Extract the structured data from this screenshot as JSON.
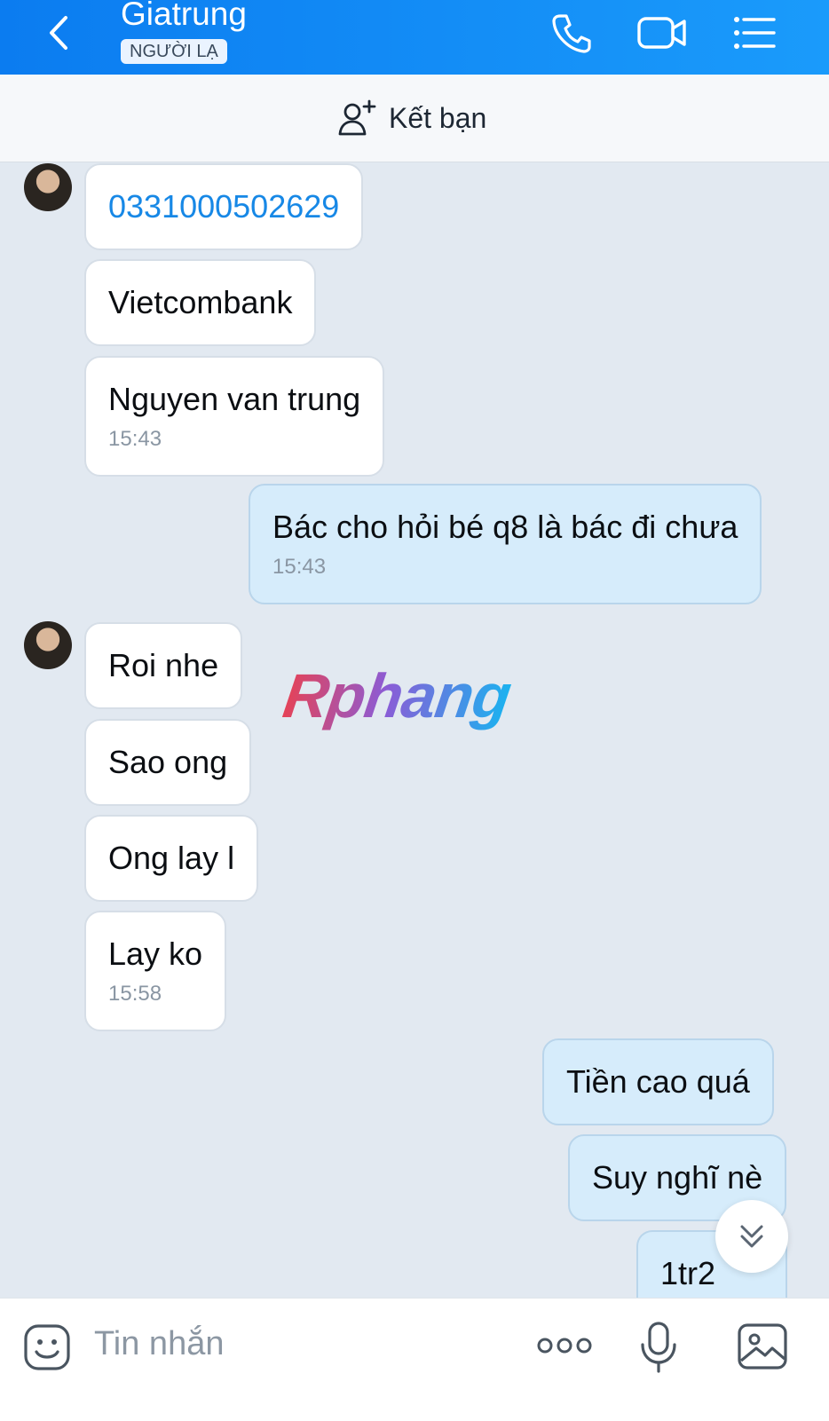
{
  "header": {
    "contact_name": "Giatrung",
    "badge": "NGƯỜI LẠ",
    "icons": [
      "back-icon",
      "phone-icon",
      "video-call-icon",
      "menu-list-icon"
    ]
  },
  "add_friend": {
    "label": "Kết bạn",
    "icon": "add-person-icon"
  },
  "messages": [
    {
      "side": "in",
      "text": "0331000502629",
      "style": "link"
    },
    {
      "side": "in",
      "text": "Vietcombank"
    },
    {
      "side": "in",
      "text": "Nguyen van trung",
      "time": "15:43"
    },
    {
      "side": "out",
      "text": "Bác cho hỏi bé q8 là bác đi chưa",
      "time": "15:43"
    },
    {
      "side": "in",
      "text": "Roi nhe"
    },
    {
      "side": "in",
      "text": "Sao ong"
    },
    {
      "side": "in",
      "text": "Ong lay l"
    },
    {
      "side": "in",
      "text": "Lay ko",
      "time": "15:58"
    },
    {
      "side": "out",
      "text": "Tiền cao quá"
    },
    {
      "side": "out",
      "text": "Suy nghĩ nè"
    },
    {
      "side": "out",
      "text": "1tr2"
    }
  ],
  "watermark": "Rphang",
  "input": {
    "placeholder": "Tin nhắn",
    "icons": [
      "sticker-icon",
      "more-icon",
      "microphone-icon",
      "image-icon"
    ]
  },
  "colors": {
    "header": "#0b7cf0",
    "outgoing_bubble": "#d6ecfb",
    "incoming_bubble": "#ffffff",
    "link": "#1788e6"
  }
}
